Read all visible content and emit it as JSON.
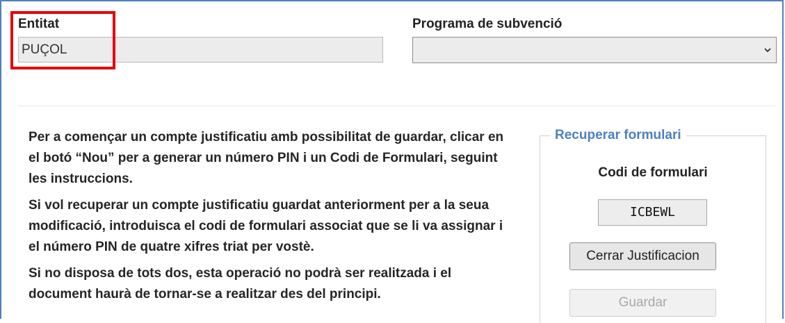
{
  "entitat": {
    "label": "Entitat",
    "value": "PUÇOL"
  },
  "programa": {
    "label": "Programa de subvenció",
    "selected": ""
  },
  "instructions": {
    "p1": "Per a començar un compte justificatiu amb possibilitat de guardar, clicar en el botó “Nou” per a generar un número PIN i un Codi de Formulari, seguint les instruccions.",
    "p2": "Si vol recuperar un compte justificatiu guardat anteriorment per a la seua modificació, introduisca el codi de formulari associat que se li va assignar i el número PIN de quatre xifres triat per vostè.",
    "p3": "Si no disposa de tots dos, esta operació no podrà ser realitzada i el document haurà de tornar-se a realitzar des del principi."
  },
  "recuperar": {
    "legend": "Recuperar formulari",
    "codi_label": "Codi de formulari",
    "codi_value": "ICBEWL",
    "cerrar_label": "Cerrar Justificacion",
    "guardar_label": "Guardar"
  },
  "colors": {
    "accent": "#4e7fbf",
    "highlight": "#e8000b"
  }
}
